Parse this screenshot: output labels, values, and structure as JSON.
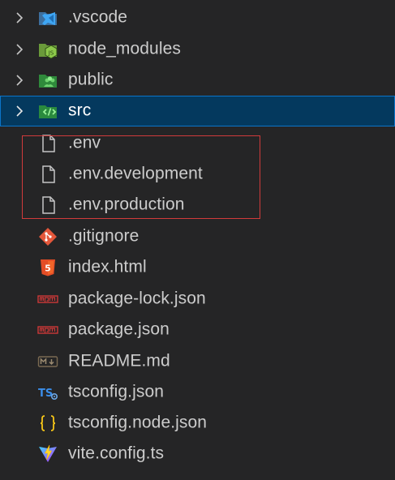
{
  "explorer": {
    "items": [
      {
        "label": ".vscode",
        "kind": "folder",
        "icon": "vscode-folder-icon",
        "selected": false
      },
      {
        "label": "node_modules",
        "kind": "folder",
        "icon": "node-modules-folder-icon",
        "selected": false
      },
      {
        "label": "public",
        "kind": "folder",
        "icon": "public-folder-icon",
        "selected": false
      },
      {
        "label": "src",
        "kind": "folder",
        "icon": "src-folder-icon",
        "selected": true
      },
      {
        "label": ".env",
        "kind": "file",
        "icon": "file-icon",
        "selected": false
      },
      {
        "label": ".env.development",
        "kind": "file",
        "icon": "file-icon",
        "selected": false
      },
      {
        "label": ".env.production",
        "kind": "file",
        "icon": "file-icon",
        "selected": false
      },
      {
        "label": ".gitignore",
        "kind": "file",
        "icon": "git-icon",
        "selected": false
      },
      {
        "label": "index.html",
        "kind": "file",
        "icon": "html5-icon",
        "selected": false
      },
      {
        "label": "package-lock.json",
        "kind": "file",
        "icon": "npm-icon",
        "selected": false
      },
      {
        "label": "package.json",
        "kind": "file",
        "icon": "npm-icon",
        "selected": false
      },
      {
        "label": "README.md",
        "kind": "file",
        "icon": "markdown-icon",
        "selected": false
      },
      {
        "label": "tsconfig.json",
        "kind": "file",
        "icon": "tsconfig-icon",
        "selected": false
      },
      {
        "label": "tsconfig.node.json",
        "kind": "file",
        "icon": "json-braces-icon",
        "selected": false
      },
      {
        "label": "vite.config.ts",
        "kind": "file",
        "icon": "vite-icon",
        "selected": false
      }
    ]
  },
  "colors": {
    "background": "#252526",
    "selected_background": "#04395e",
    "selected_border": "#0b74c9",
    "text": "#cccccc",
    "highlight_box": "#d13b3b"
  }
}
